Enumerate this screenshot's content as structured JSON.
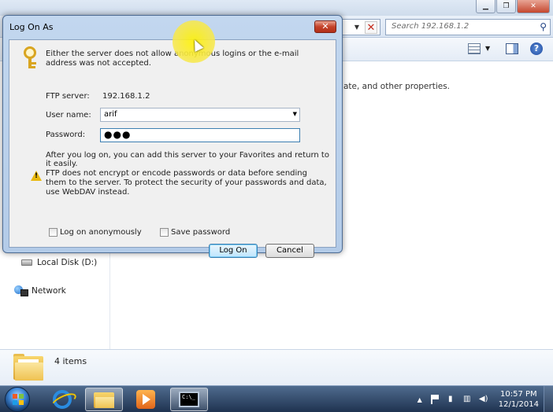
{
  "explorer": {
    "search_placeholder": "Search 192.168.1.2",
    "content_partial_text": "ate, and other properties.",
    "nav": {
      "local_disk": "Local Disk (D:)",
      "network": "Network"
    },
    "details": {
      "items_count": "4 items"
    }
  },
  "dialog": {
    "title": "Log On As",
    "message": "Either the server does not allow anonymous logins or the e-mail address was not accepted.",
    "ftp_server_label": "FTP server:",
    "ftp_server_value": "192.168.1.2",
    "username_label": "User name:",
    "username_value": "arif",
    "password_label": "Password:",
    "password_value": "●●●",
    "info_text": "After you log on, you can add this server to your Favorites and return to it easily.",
    "warning_text": "FTP does not encrypt or encode passwords or data before sending them to the server.  To protect the security of your passwords and data, use WebDAV instead.",
    "anonymous_label": "Log on anonymously",
    "save_password_label": "Save password",
    "logon_button": "Log On",
    "cancel_button": "Cancel"
  },
  "taskbar": {
    "time": "10:57 PM",
    "date": "12/1/2014"
  }
}
